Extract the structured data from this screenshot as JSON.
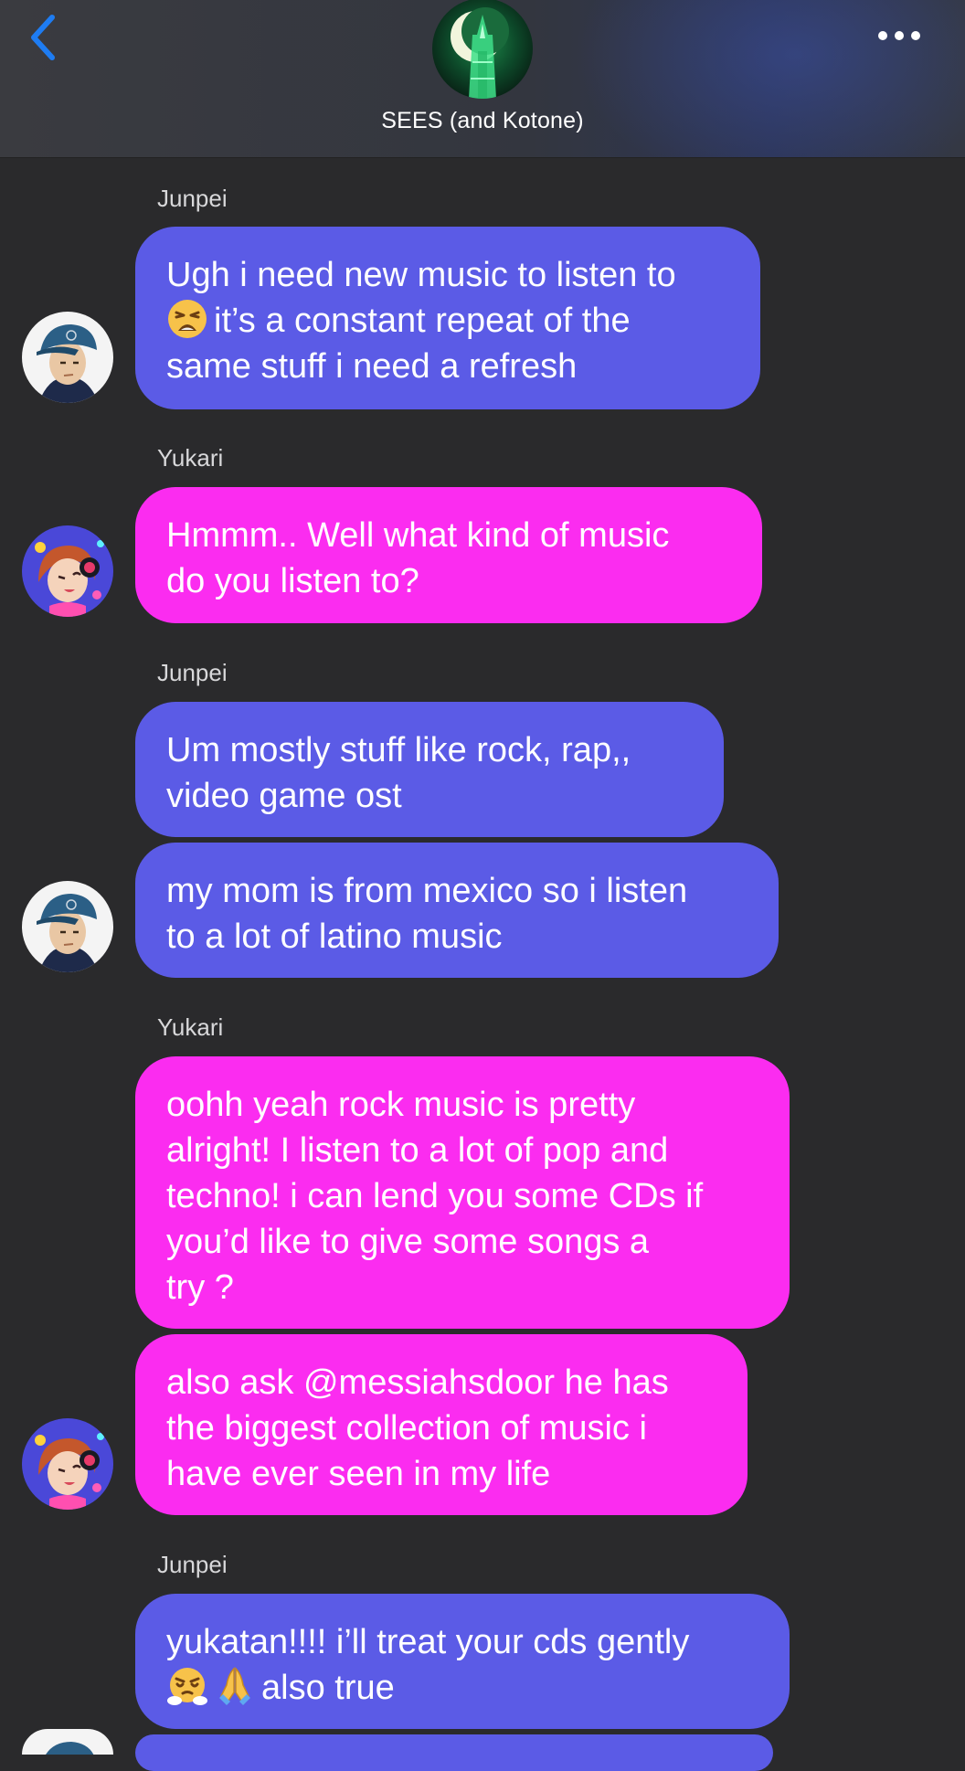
{
  "header": {
    "title": "SEES (and Kotone)",
    "back_icon": "chevron-left-icon",
    "more_icon": "ellipsis-icon",
    "accent_color": "#1e7cf2"
  },
  "colors": {
    "junpei_bubble": "#5b5be6",
    "yukari_bubble": "#fb2cf0",
    "background": "#2a2a2c"
  },
  "messages": [
    {
      "sender": "Junpei",
      "bubbles": [
        {
          "line1": "Ugh i need new music to listen to",
          "line2_emoji": "weary-face-emoji",
          "line2": "it’s a constant repeat of the",
          "line3": "same stuff i need a refresh"
        }
      ]
    },
    {
      "sender": "Yukari",
      "bubbles": [
        {
          "line1": "Hmmm.. Well what kind of music",
          "line2": "do you listen to?"
        }
      ]
    },
    {
      "sender": "Junpei",
      "bubbles": [
        {
          "line1": "Um mostly stuff like rock, rap,,",
          "line2": "video game ost"
        },
        {
          "line1": "my mom is from mexico so i listen",
          "line2": "to a lot of latino music"
        }
      ]
    },
    {
      "sender": "Yukari",
      "bubbles": [
        {
          "line1": "oohh yeah rock music is pretty",
          "line2": "alright! I listen to a lot of pop and",
          "line3": "techno! i can lend you some CDs if",
          "line4": "you’d like to give some songs a",
          "line5": "try ?"
        },
        {
          "line1": "also ask @messiahsdoor he has",
          "line2": "the biggest collection of music i",
          "line3": "have ever seen in my life"
        }
      ]
    },
    {
      "sender": "Junpei",
      "bubbles": [
        {
          "line1": "yukatan!!!! i’ll treat your cds gently",
          "line2_emojis": [
            "steam-from-nose-emoji",
            "folded-hands-emoji"
          ],
          "line2": "also true"
        }
      ]
    }
  ]
}
